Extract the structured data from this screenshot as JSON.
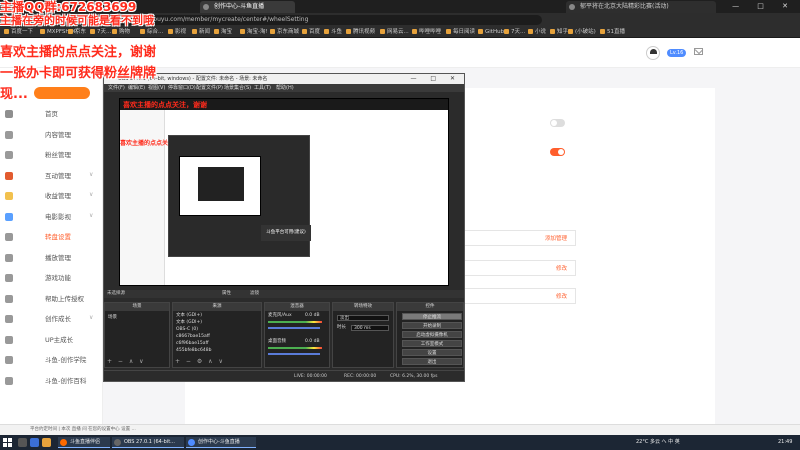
{
  "browser": {
    "tabs": [
      {
        "label": "创作中心-斗鱼直播",
        "active": true
      },
      {
        "label": "创作中心-斗鱼直播",
        "active": false
      }
    ],
    "url": "https://www.douyu.com/creator/#/createCenter/wheelSetting",
    "url_visible": "https://www.douyu.com/member/mycreate/center#/wheelSetting",
    "tab_search_placeholder": "郁平将在北京大陆精彩比赛(活动)",
    "bookmarks": [
      "百度一下",
      "MXPFSHOP",
      "京东",
      "7天...",
      "购物",
      "综合...",
      "影视",
      "新闻",
      "淘宝",
      "淘宝-淘!",
      "京东商城",
      "百度",
      "斗鱼",
      "腾讯视频",
      "网易云...",
      "哔哩哔哩",
      "每日阅读",
      "GitHub",
      "7天...",
      "小说",
      "知乎",
      "(小破站)",
      "51直播"
    ]
  },
  "stream_overlay": {
    "top_text": "主播QQ群:672683699",
    "sub_text": "主播在旁的时候可能是看不到哦",
    "lines": [
      "喜欢主播的点点关注，谢谢",
      "一张办卡即可获得粉丝牌牌",
      "现..."
    ]
  },
  "header": {
    "level_badge": "Lv.16",
    "avatar_icon": "user-avatar",
    "mail_icon": "mail-icon"
  },
  "sidebar": {
    "items": [
      {
        "label": "首页",
        "chevron": false,
        "selected": false
      },
      {
        "label": "内容管理",
        "chevron": false,
        "selected": false
      },
      {
        "label": "粉丝管理",
        "chevron": false,
        "selected": false
      },
      {
        "label": "互动管理",
        "chevron": true,
        "selected": false
      },
      {
        "label": "收益管理",
        "chevron": true,
        "selected": false
      },
      {
        "label": "电影影视",
        "chevron": true,
        "selected": false
      },
      {
        "label": "转盘设置",
        "chevron": false,
        "selected": true
      },
      {
        "label": "播放管理",
        "chevron": false,
        "selected": false
      },
      {
        "label": "游戏功能",
        "chevron": false,
        "selected": false
      },
      {
        "label": "帮助上传授权",
        "chevron": false,
        "selected": false
      },
      {
        "label": "创作成长",
        "chevron": true,
        "selected": false
      },
      {
        "label": "UP主成长",
        "chevron": false,
        "selected": false
      },
      {
        "label": "斗鱼-创作学院",
        "chevron": false,
        "selected": false
      },
      {
        "label": "斗鱼-创作百科",
        "chevron": false,
        "selected": false
      }
    ]
  },
  "main": {
    "option_rows": [
      "添加管理",
      "修改",
      "修改"
    ]
  },
  "obs": {
    "title": "OBS 27.0.1 (64-bit, windows) - 配置文件: 未命名 - 场景: 未命名",
    "menus": [
      "文件(F)",
      "编辑(E)",
      "视图(V)",
      "停靠窗口(D)",
      "配置文件(P)",
      "场景集合(S)",
      "工具(T)",
      "帮助(H)"
    ],
    "preview": {
      "nested_red": "喜欢主播的点点关注，谢谢",
      "nested_red2": "喜欢主播的点点关注，谢谢 张办卡即可获得粉丝牌牌",
      "tooltip": "斗鱼平台可用(建议)"
    },
    "toolbar_labels": [
      "未选择源",
      "属性",
      "滤镜"
    ],
    "docks": {
      "scenes": {
        "title": "场景",
        "items": [
          "场景"
        ]
      },
      "sources": {
        "title": "来源",
        "items": [
          "文本 (GDI+)",
          "文本 (GDI+)",
          "OBS-C (0)",
          "c8667bae15aff",
          "c6f96bae15aff",
          "455bfe8bc648b"
        ]
      },
      "mixer": {
        "title": "混音器",
        "tracks": [
          {
            "name": "麦克风/Aux",
            "level": "0.0 dB"
          },
          {
            "name": "桌面音频",
            "level": "0.0 dB"
          }
        ]
      },
      "transitions": {
        "title": "转场特效",
        "type": "淡出",
        "duration_label": "时长",
        "duration": "300 ms"
      },
      "controls": {
        "title": "控件",
        "buttons": [
          {
            "label": "停止推流",
            "active": true
          },
          {
            "label": "开始录制",
            "active": false
          },
          {
            "label": "启动虚拟摄像机",
            "active": false
          },
          {
            "label": "工作室模式",
            "active": false
          },
          {
            "label": "设置",
            "active": false
          },
          {
            "label": "退出",
            "active": false
          }
        ]
      }
    },
    "status": {
      "live": "LIVE: 00:00:00",
      "rec": "REC: 00:00:00",
      "cpu": "CPU: 6.2%, 30.00 fps",
      "kbps": "kb/s: 0"
    }
  },
  "notification": "平台约定时间 | 本次 直播 间 在您的设置中心 设置 ...",
  "taskbar": {
    "apps": [
      {
        "label": "斗鱼直播伴侣",
        "color": "#ff6a00"
      },
      {
        "label": "OBS 27.0.1 (64-bit...",
        "color": "#2a2a2a"
      },
      {
        "label": "创作中心-斗鱼直播",
        "color": "#4f8cff"
      }
    ],
    "tray": "22°C 多云 へ 中 英",
    "clock": "21:49"
  },
  "colors": {
    "accent": "#ff5e2c",
    "overlay_red": "#ff2b1c",
    "taskbar": "#1c2634"
  }
}
